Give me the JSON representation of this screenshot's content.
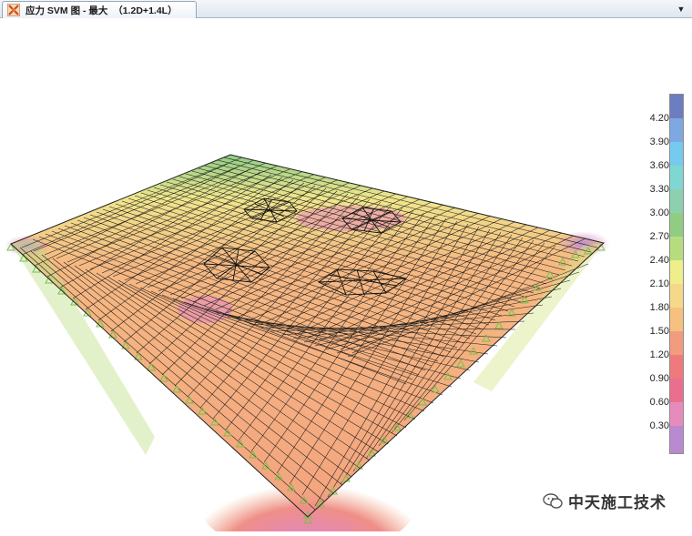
{
  "tab": {
    "title": "应力 SVM 图 - 最大  （1.2D+1.4L）",
    "icon": "model-icon"
  },
  "dropdown": {
    "symbol": "▼"
  },
  "legend": {
    "labels": [
      "4.20",
      "3.90",
      "3.60",
      "3.30",
      "3.00",
      "2.70",
      "2.40",
      "2.10",
      "1.80",
      "1.50",
      "1.20",
      "0.90",
      "0.60",
      "0.30"
    ],
    "colors": [
      "#6c7ec0",
      "#7ea9e0",
      "#74cbed",
      "#7fd7d3",
      "#8dd0b0",
      "#90cd82",
      "#b7dc7d",
      "#eeee8a",
      "#f6d88a",
      "#f6c180",
      "#f19c7e",
      "#ef7a7e",
      "#ea6f8e",
      "#e68cbd",
      "#b98ad0"
    ]
  },
  "watermark": {
    "text": "中天施工技术",
    "icon": "wechat-icon"
  }
}
